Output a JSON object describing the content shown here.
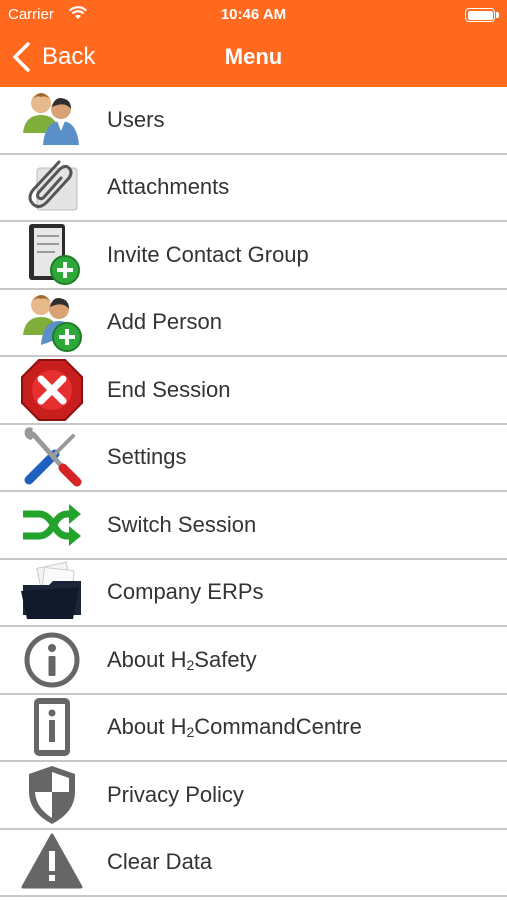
{
  "status_bar": {
    "carrier": "Carrier",
    "time": "10:46 AM",
    "wifi_icon": "wifi-icon",
    "battery_icon": "battery-icon"
  },
  "nav": {
    "back_label": "Back",
    "title": "Menu"
  },
  "colors": {
    "header": "#ff6a1f",
    "divider": "#c8c8c8",
    "text": "#333333"
  },
  "menu": [
    {
      "label": "Users",
      "icon": "users-icon"
    },
    {
      "label": "Attachments",
      "icon": "paperclip-icon"
    },
    {
      "label": "Invite Contact Group",
      "icon": "contact-book-add-icon"
    },
    {
      "label": "Add Person",
      "icon": "add-person-icon"
    },
    {
      "label": "End Session",
      "icon": "stop-x-icon"
    },
    {
      "label": "Settings",
      "icon": "tools-icon"
    },
    {
      "label": "Switch Session",
      "icon": "shuffle-icon"
    },
    {
      "label": "Company ERPs",
      "icon": "folder-icon"
    },
    {
      "label_pre": "About H",
      "label_sub": "2",
      "label_post": "Safety",
      "icon": "info-circle-icon"
    },
    {
      "label_pre": "About H",
      "label_sub": "2",
      "label_post": "CommandCentre",
      "icon": "info-device-icon"
    },
    {
      "label": "Privacy Policy",
      "icon": "shield-icon"
    },
    {
      "label": "Clear Data",
      "icon": "warning-icon"
    }
  ]
}
